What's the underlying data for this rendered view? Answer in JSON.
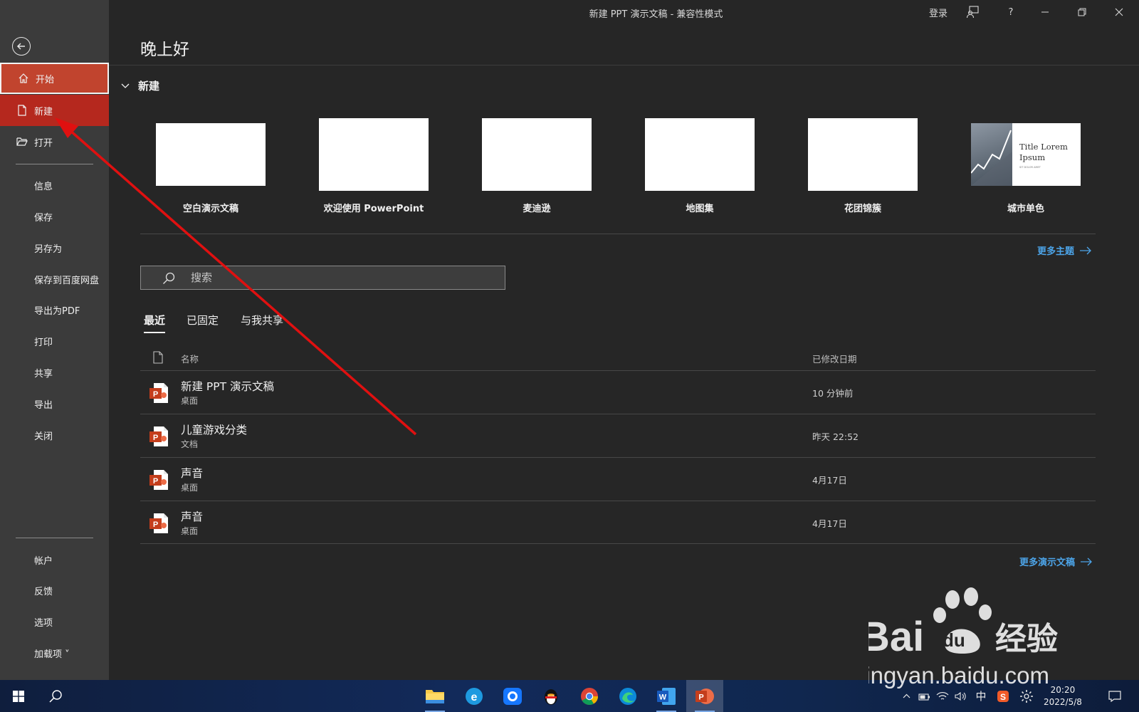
{
  "window": {
    "title": "新建 PPT 演示文稿  -  兼容性模式",
    "signin_label": "登录",
    "help_label": "?"
  },
  "sidebar": {
    "items": [
      {
        "label": "开始",
        "icon": "home-icon"
      },
      {
        "label": "新建",
        "icon": "new-file-icon"
      },
      {
        "label": "打开",
        "icon": "open-folder-icon"
      },
      {
        "label": "信息"
      },
      {
        "label": "保存"
      },
      {
        "label": "另存为"
      },
      {
        "label": "保存到百度网盘"
      },
      {
        "label": "导出为PDF"
      },
      {
        "label": "打印"
      },
      {
        "label": "共享"
      },
      {
        "label": "导出"
      },
      {
        "label": "关闭"
      }
    ],
    "bottom_items": [
      {
        "label": "帐户"
      },
      {
        "label": "反馈"
      },
      {
        "label": "选项"
      },
      {
        "label": "加载项 ˅"
      }
    ]
  },
  "main": {
    "greeting": "晚上好",
    "new_section_label": "新建",
    "templates": [
      {
        "label": "空白演示文稿"
      },
      {
        "label": "欢迎使用 PowerPoint"
      },
      {
        "label": "麦迪逊"
      },
      {
        "label": "地图集"
      },
      {
        "label": "花团锦簇"
      },
      {
        "label": "城市单色",
        "thumb_title": "Title Lorem Ipsum",
        "thumb_sub": "SIT DOLOR AMET"
      }
    ],
    "more_themes": "更多主题",
    "search_placeholder": "搜索",
    "tabs": [
      "最近",
      "已固定",
      "与我共享"
    ],
    "list_headers": {
      "name": "名称",
      "date": "已修改日期"
    },
    "files": [
      {
        "name": "新建 PPT 演示文稿",
        "location": "桌面",
        "modified": "10 分钟前"
      },
      {
        "name": "儿童游戏分类",
        "location": "文档",
        "modified": "昨天 22:52"
      },
      {
        "name": "声音",
        "location": "桌面",
        "modified": "4月17日"
      },
      {
        "name": "声音",
        "location": "桌面",
        "modified": "4月17日"
      }
    ],
    "more_presentations": "更多演示文稿"
  },
  "taskbar": {
    "ime_label": "中",
    "time": "20:20",
    "date": "2022/5/8"
  },
  "watermark": {
    "brand": "Baidu经验",
    "url": "jingyan.baidu.com"
  },
  "colors": {
    "accent_blue": "#4ca4e8",
    "sidebar_active": "#b5281e",
    "annotation_arrow": "#e01010"
  }
}
